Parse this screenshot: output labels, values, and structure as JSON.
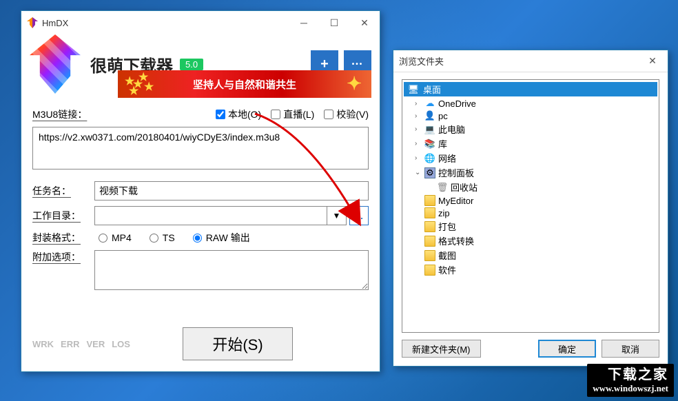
{
  "app": {
    "window_title": "HmDX",
    "name": "很萌下载器",
    "version_badge": "5.0",
    "banner": "坚持人与自然和谐共生",
    "labels": {
      "m3u8": "M3U8链接：",
      "local": "本地(O)",
      "live": "直播(L)",
      "verify": "校验(V)",
      "task": "任务名：",
      "workdir": "工作目录：",
      "format": "封装格式：",
      "mp4": "MP4",
      "ts": "TS",
      "raw": "RAW 输出",
      "extra": "附加选项：",
      "start": "开始(S)"
    },
    "values": {
      "url": "https://v2.xw0371.com/20180401/wiyCDyE3/index.m3u8",
      "task_name": "视频下载",
      "workdir": ""
    },
    "stats": [
      "WRK",
      "ERR",
      "VER",
      "LOS"
    ]
  },
  "dlg": {
    "title": "浏览文件夹",
    "root": "桌面",
    "items": [
      {
        "icon": "cloud",
        "label": "OneDrive",
        "exp": ">"
      },
      {
        "icon": "pc",
        "label": "pc",
        "exp": ">"
      },
      {
        "icon": "mon",
        "label": "此电脑",
        "exp": ">"
      },
      {
        "icon": "lib",
        "label": "库",
        "exp": ">"
      },
      {
        "icon": "net",
        "label": "网络",
        "exp": ">"
      },
      {
        "icon": "cp",
        "label": "控制面板",
        "exp": "v"
      },
      {
        "icon": "rec",
        "label": "回收站",
        "exp": "",
        "indent": 1
      },
      {
        "icon": "folder",
        "label": "MyEditor",
        "exp": "",
        "indent": 0
      },
      {
        "icon": "folder",
        "label": "zip",
        "exp": "",
        "indent": 0
      },
      {
        "icon": "folder",
        "label": "打包",
        "exp": "",
        "indent": 0
      },
      {
        "icon": "folder",
        "label": "格式转换",
        "exp": "",
        "indent": 0
      },
      {
        "icon": "folder",
        "label": "截图",
        "exp": "",
        "indent": 0
      },
      {
        "icon": "folder",
        "label": "软件",
        "exp": "",
        "indent": 0
      }
    ],
    "buttons": {
      "new": "新建文件夹(M)",
      "ok": "确定",
      "cancel": "取消"
    }
  },
  "watermark": {
    "big": "下载之家",
    "url": "www.windowszj.net"
  }
}
